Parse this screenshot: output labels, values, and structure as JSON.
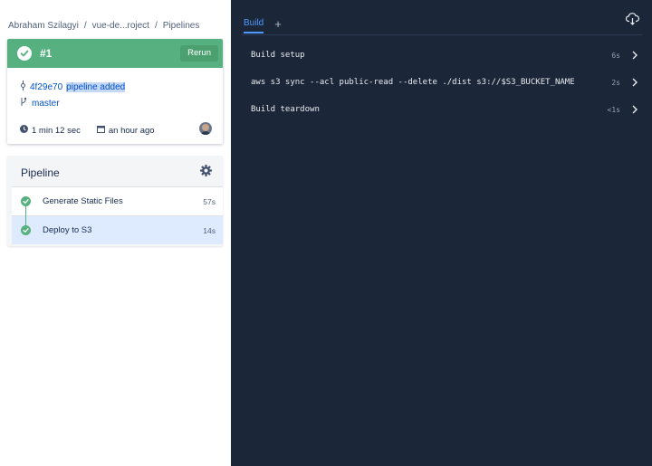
{
  "breadcrumb": {
    "user": "Abraham Szilagyi",
    "repo": "vue-de...roject",
    "section": "Pipelines",
    "separator": "/"
  },
  "build": {
    "number": "#1",
    "rerun_label": "Rerun",
    "commit_hash": "4f29e70",
    "commit_message": "pipeline added",
    "branch": "master",
    "duration": "1 min 12 sec",
    "time_ago": "an hour ago",
    "status_color": "#57b07f"
  },
  "pipeline": {
    "title": "Pipeline",
    "steps": [
      {
        "name": "Generate Static Files",
        "duration": "57s",
        "status": "success"
      },
      {
        "name": "Deploy to S3",
        "duration": "14s",
        "status": "success",
        "selected": true
      }
    ]
  },
  "log_panel": {
    "tabs": [
      {
        "label": "Build",
        "active": true
      }
    ],
    "add_tab_label": "+",
    "rows": [
      {
        "command": "Build setup",
        "time": "6s"
      },
      {
        "command": "aws s3 sync --acl public-read --delete ./dist s3://$S3_BUCKET_NAME",
        "time": "2s"
      },
      {
        "command": "Build teardown",
        "time": "<1s"
      }
    ],
    "background": "#1b2638",
    "accent": "#4c9aff"
  },
  "icons": {
    "check": "check-icon",
    "commit": "commit-icon",
    "branch": "branch-icon",
    "clock": "clock-icon",
    "calendar": "calendar-icon",
    "settings": "gear-icon",
    "download": "cloud-download-icon",
    "expand": "chevron-right-icon"
  }
}
